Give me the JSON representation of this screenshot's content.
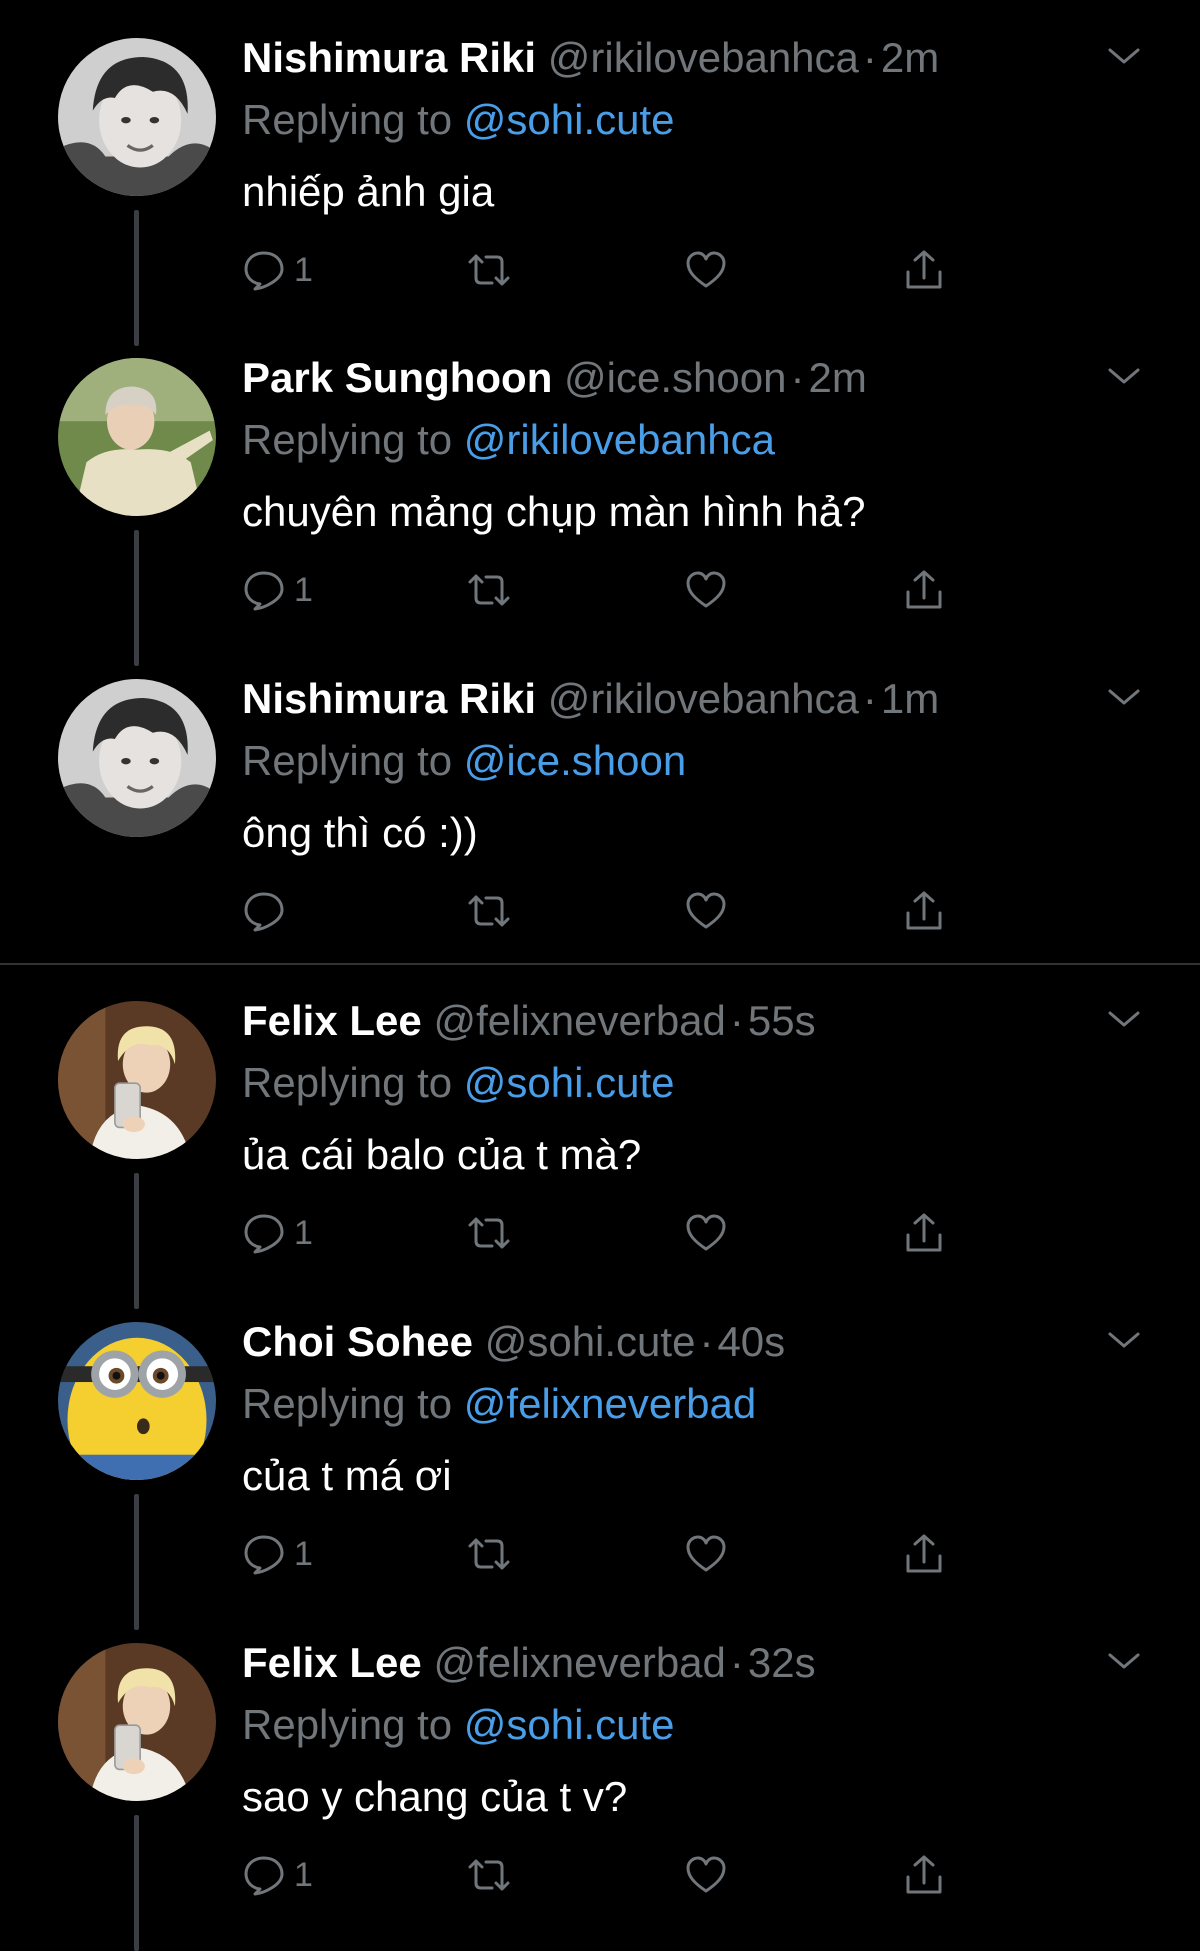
{
  "tweets": [
    {
      "name": "Nishimura Riki",
      "handle": "@rikilovebanhca",
      "dot": "·",
      "time": "2m",
      "replying_prefix": "Replying to ",
      "replying_to": "@sohi.cute",
      "text": "nhiếp ảnh gia",
      "reply_count": "1",
      "avatar": "avatar-boy-bw"
    },
    {
      "name": "Park Sunghoon",
      "handle": "@ice.shoon",
      "dot": "·",
      "time": "2m",
      "replying_prefix": "Replying to ",
      "replying_to": "@rikilovebanhca",
      "text": "chuyên mảng chụp màn hình hả?",
      "reply_count": "1",
      "avatar": "avatar-boy-field"
    },
    {
      "name": "Nishimura Riki",
      "handle": "@rikilovebanhca",
      "dot": "·",
      "time": "1m",
      "replying_prefix": "Replying to ",
      "replying_to": "@ice.shoon",
      "text": "ông thì có :))",
      "reply_count": "",
      "avatar": "avatar-boy-bw"
    },
    {
      "name": "Felix Lee",
      "handle": "@felixneverbad",
      "dot": "·",
      "time": "55s",
      "replying_prefix": "Replying to ",
      "replying_to": "@sohi.cute",
      "text": "ủa cái balo của t mà?",
      "reply_count": "1",
      "avatar": "avatar-blonde-selfie"
    },
    {
      "name": "Choi Sohee",
      "handle": "@sohi.cute",
      "dot": "·",
      "time": "40s",
      "replying_prefix": "Replying to ",
      "replying_to": "@felixneverbad",
      "text": "của t má ơi",
      "reply_count": "1",
      "avatar": "avatar-minion"
    },
    {
      "name": "Felix Lee",
      "handle": "@felixneverbad",
      "dot": "·",
      "time": "32s",
      "replying_prefix": "Replying to ",
      "replying_to": "@sohi.cute",
      "text": "sao y chang của t v?",
      "reply_count": "1",
      "avatar": "avatar-blonde-selfie"
    }
  ],
  "icons": {
    "more": "chevron-down-icon",
    "reply": "reply-bubble-icon",
    "retweet": "retweet-icon",
    "like": "heart-icon",
    "share": "share-icon"
  },
  "colors": {
    "background": "#000000",
    "primary_text": "#ffffff",
    "secondary_text": "#71767b",
    "mention": "#4a9ee8",
    "thread_line": "#3a3d41",
    "divider": "#2f3336"
  }
}
